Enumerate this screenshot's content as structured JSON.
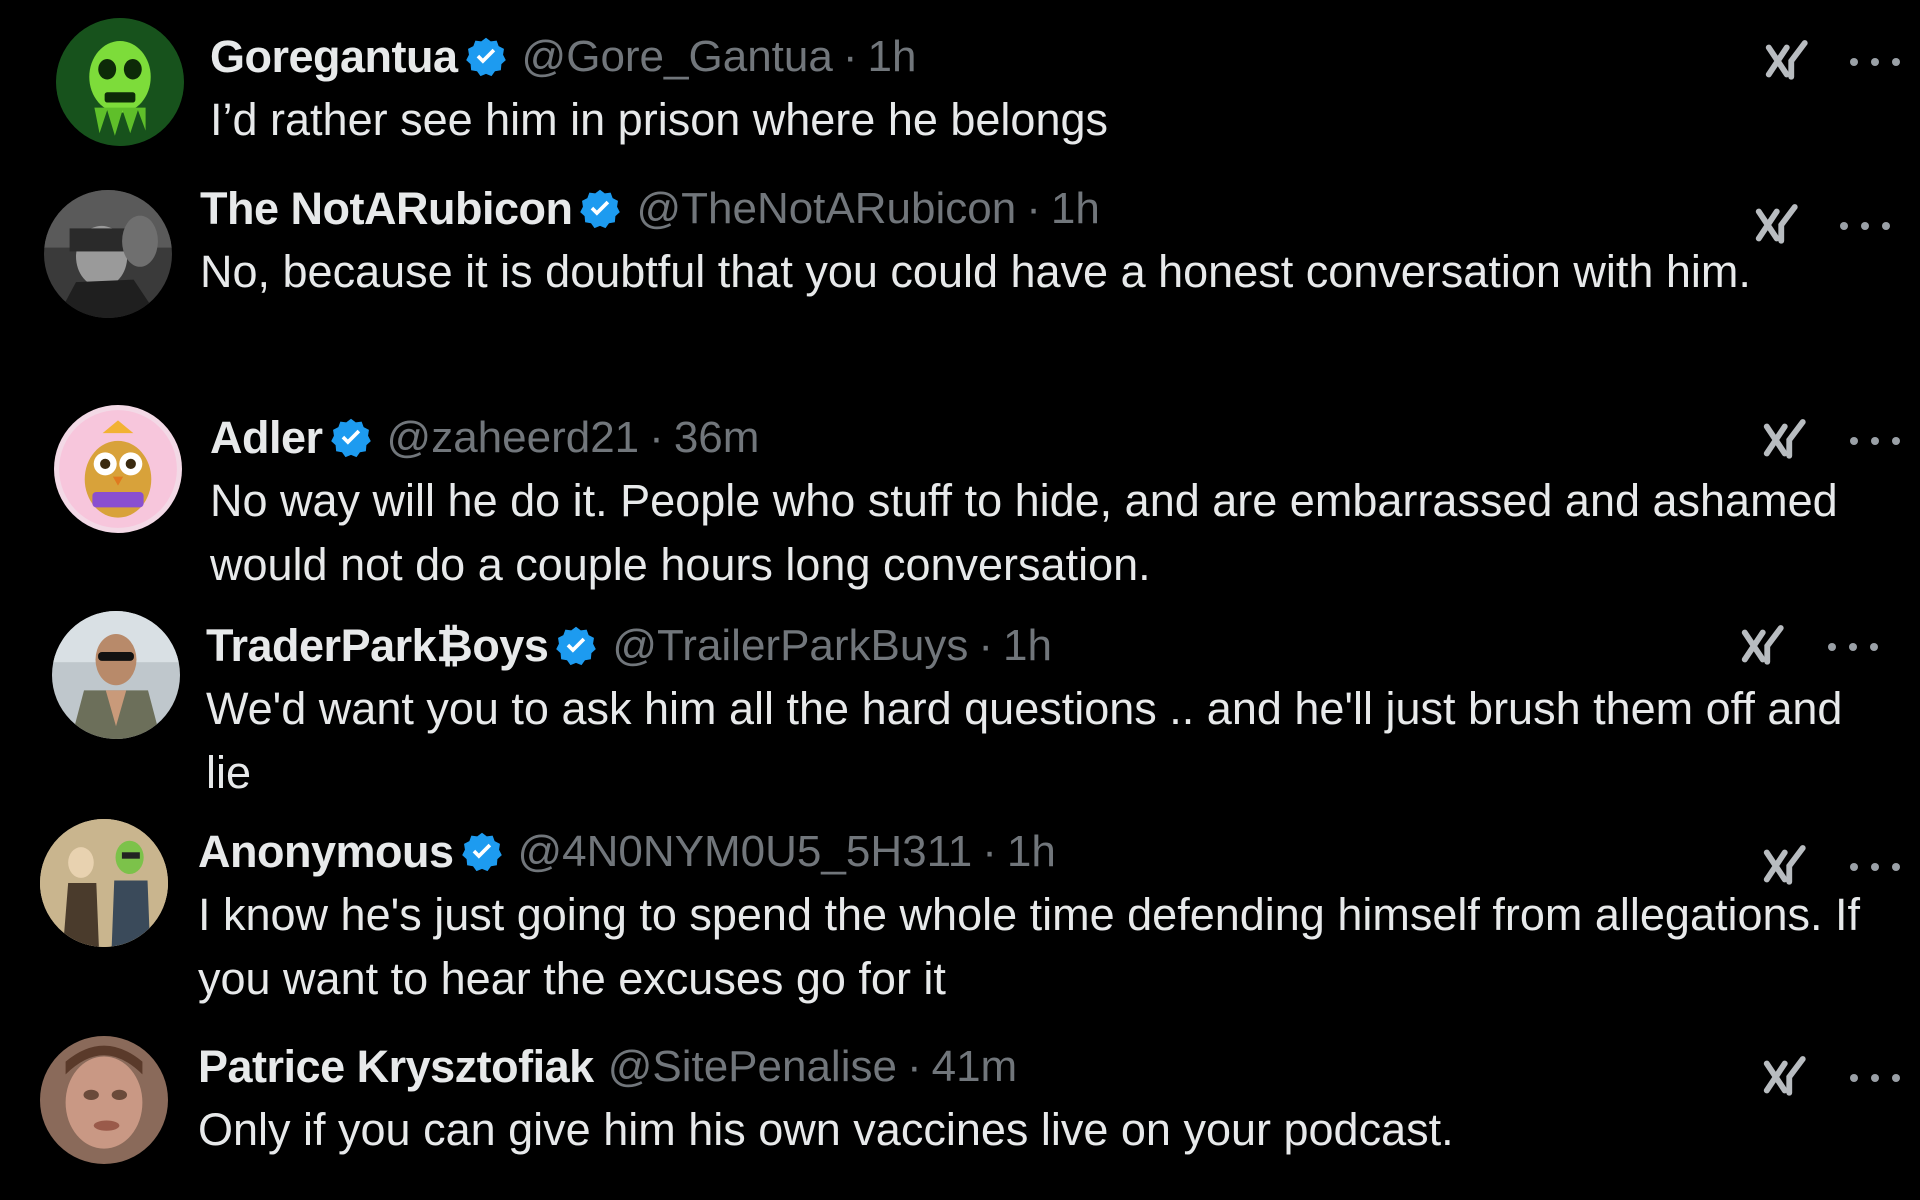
{
  "colors": {
    "background": "#000000",
    "primary_text": "#e7e9ea",
    "secondary_text": "#71767b",
    "verified_blue": "#1d9bf0"
  },
  "icons": {
    "verified": "verified-badge-icon",
    "grok": "grok-icon",
    "more": "more-options-icon"
  },
  "replies": [
    {
      "name": "Goregantua",
      "handle": "@Gore_Gantua",
      "separator": "·",
      "time": "1h",
      "text": "I’d rather see him in prison where he belongs",
      "avatar": "green-zombie-avatar"
    },
    {
      "name": "The NotARubicon",
      "handle": "@TheNotARubicon",
      "separator": "·",
      "time": "1h",
      "text": "No, because it is doubtful that you could have a honest conversation with him.",
      "avatar": "grayscale-photo-avatar"
    },
    {
      "name": "Adler",
      "handle": "@zaheerd21",
      "separator": "·",
      "time": "36m",
      "text": "No way will he do it. People who stuff to hide, and are embarrassed and ashamed would not do a couple hours long conversation.",
      "avatar": "cartoon-owl-avatar"
    },
    {
      "name": "TraderPark₿oys",
      "handle": "@TrailerParkBuys",
      "separator": "·",
      "time": "1h",
      "text": "We'd want you to ask him all the hard questions  .. and he'll just brush them off and lie",
      "avatar": "man-sunglasses-avatar"
    },
    {
      "name": "Anonymous",
      "handle": "@4N0NYM0U5_5H311",
      "separator": "·",
      "time": "1h",
      "text": "I know he's just going to spend the whole time defending himself from allegations. If you want to hear the excuses go for it",
      "avatar": "illustrated-figures-avatar"
    },
    {
      "name": "Patrice Krysztofiak",
      "handle": "@SitePenalise",
      "separator": "·",
      "time": "41m",
      "text": "Only if you can give him his own vaccines live on your podcast.",
      "avatar": "blurred-face-avatar"
    }
  ]
}
